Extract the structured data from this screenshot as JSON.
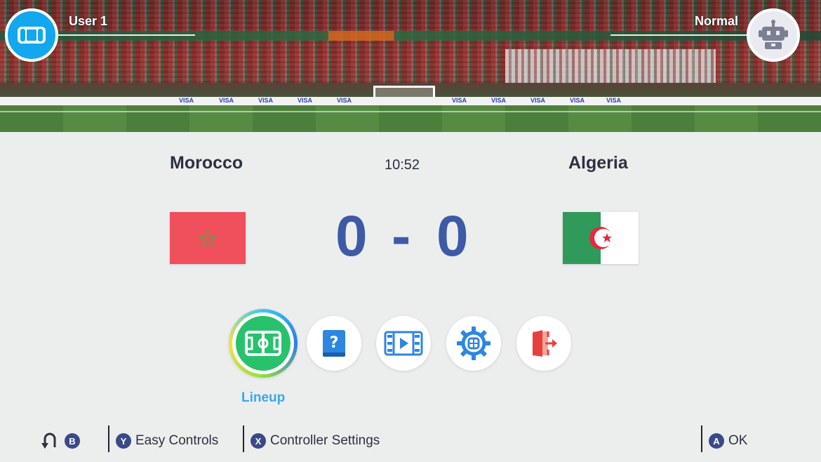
{
  "header": {
    "player_left": {
      "name": "User 1",
      "icon": "handheld-console-icon"
    },
    "player_right": {
      "name": "Normal",
      "icon": "robot-icon"
    }
  },
  "match": {
    "home": {
      "name": "Morocco",
      "score": "0",
      "flag": "morocco-flag"
    },
    "away": {
      "name": "Algeria",
      "score": "0",
      "flag": "algeria-flag"
    },
    "separator": "-",
    "clock": "10:52"
  },
  "menu": {
    "selected_label": "Lineup",
    "items": [
      {
        "name": "lineup",
        "icon": "pitch-icon",
        "selected": true
      },
      {
        "name": "help",
        "icon": "question-book-icon"
      },
      {
        "name": "replay",
        "icon": "film-play-icon"
      },
      {
        "name": "settings",
        "icon": "gear-icon"
      },
      {
        "name": "quit",
        "icon": "exit-door-icon"
      }
    ]
  },
  "stadium": {
    "ad_text": "VISA"
  },
  "footer": {
    "back": {
      "button": "B",
      "icon": "back-arrow-icon"
    },
    "easy_controls": {
      "button": "Y",
      "label": "Easy Controls"
    },
    "controller_settings": {
      "button": "X",
      "label": "Controller Settings"
    },
    "ok": {
      "button": "A",
      "label": "OK"
    }
  },
  "colors": {
    "accent_blue": "#3d5aa6",
    "selected_green": "#29c26c",
    "label_blue": "#3aa8e8",
    "avatar_blue": "#12a7ee"
  }
}
